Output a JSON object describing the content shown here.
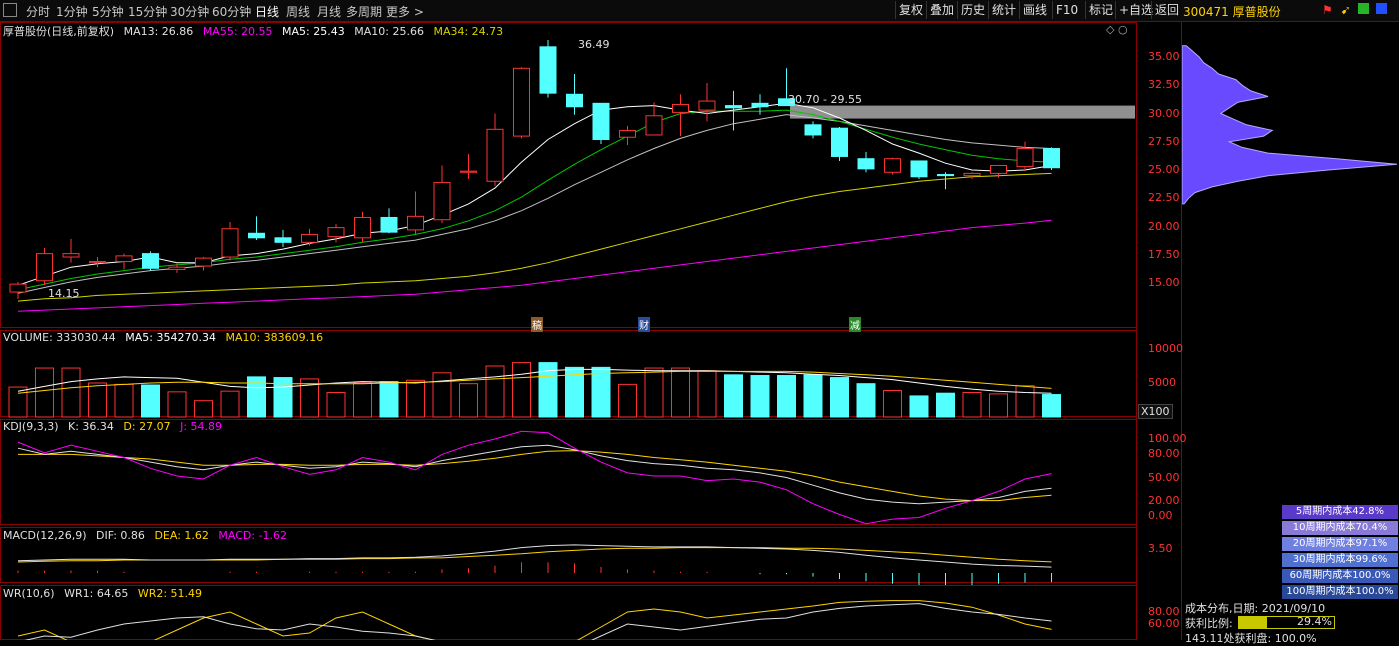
{
  "toolbar": {
    "period_tabs": [
      "分时",
      "1分钟",
      "5分钟",
      "15分钟",
      "30分钟",
      "60分钟",
      "日线",
      "周线",
      "月线",
      "多周期",
      "更多 >"
    ],
    "active_tab": "日线",
    "buttons": [
      "复权",
      "叠加",
      "历史",
      "统计",
      "画线",
      "F10",
      "标记",
      "+自选",
      "返回"
    ]
  },
  "stock": {
    "code_name": "300471 厚普股份",
    "title": "厚普股份(日线,前复权)"
  },
  "ma_legend": {
    "ma13": "MA13: 26.86",
    "ma55": "MA55: 20.55",
    "ma5": "MA5: 25.43",
    "ma10": "MA10: 25.66",
    "ma34": "MA34: 24.73"
  },
  "price_axis": [
    "35.00",
    "32.50",
    "30.00",
    "27.50",
    "25.00",
    "22.50",
    "20.00",
    "17.50",
    "15.00"
  ],
  "annotations": {
    "high": "36.49",
    "low": "14.15",
    "range": "30.70 - 29.55"
  },
  "markers": [
    "稿",
    "财",
    "减"
  ],
  "volume": {
    "legend_name": "VOLUME: 333030.44",
    "ma5": "MA5: 354270.34",
    "ma10": "MA10: 383609.16",
    "axis": [
      "10000",
      "5000"
    ],
    "unit": "X100"
  },
  "kdj": {
    "legend_name": "KDJ(9,3,3)",
    "k": "K: 36.34",
    "d": "D: 27.07",
    "j": "J: 54.89",
    "axis": [
      "100.00",
      "80.00",
      "50.00",
      "20.00",
      "0.00"
    ]
  },
  "macd": {
    "legend_name": "MACD(12,26,9)",
    "dif": "DIF: 0.86",
    "dea": "DEA: 1.62",
    "macd": "MACD: -1.62",
    "axis": [
      "3.50"
    ]
  },
  "wr": {
    "legend_name": "WR(10,6)",
    "wr1": "WR1: 64.65",
    "wr2": "WR2: 51.49",
    "axis": [
      "80.00",
      "60.00"
    ]
  },
  "cost_distribution": {
    "rows": [
      "5周期内成本42.8%",
      "10周期内成本70.4%",
      "20周期内成本97.1%",
      "30周期内成本99.6%",
      "60周期内成本100.0%",
      "100周期内成本100.0%"
    ],
    "date_line": "成本分布,日期: 2021/09/10",
    "profit_label": "获利比例:",
    "profit_value": "29.4%",
    "profit_fraction": 0.294,
    "bottom_line": "143.11处获利盘: 100.0%"
  },
  "colors": {
    "up": "#ff3232",
    "down": "#54ffff",
    "ma5": "#ffffff",
    "ma10": "#00c800",
    "ma13": "#c0c0c0",
    "ma34": "#d4d400",
    "ma55": "#ff00ff"
  },
  "candles": [
    [
      14.2,
      15.1,
      13.6,
      14.9
    ],
    [
      15.2,
      18.1,
      14.8,
      17.6
    ],
    [
      17.3,
      18.9,
      16.8,
      17.6
    ],
    [
      16.8,
      17.3,
      16.4,
      16.9
    ],
    [
      16.9,
      17.6,
      16.2,
      17.4
    ],
    [
      17.6,
      17.8,
      16.1,
      16.3
    ],
    [
      16.2,
      16.7,
      15.9,
      16.4
    ],
    [
      16.5,
      17.3,
      16.1,
      17.2
    ],
    [
      17.3,
      20.4,
      17.0,
      19.8
    ],
    [
      19.4,
      20.9,
      18.8,
      19.0
    ],
    [
      19.0,
      19.7,
      18.2,
      18.6
    ],
    [
      18.6,
      19.8,
      18.3,
      19.3
    ],
    [
      19.1,
      20.2,
      18.6,
      19.9
    ],
    [
      19.0,
      21.3,
      18.6,
      20.8
    ],
    [
      20.8,
      21.6,
      19.4,
      19.5
    ],
    [
      19.7,
      23.1,
      19.3,
      20.9
    ],
    [
      20.6,
      25.4,
      20.3,
      23.9
    ],
    [
      24.8,
      26.4,
      24.2,
      24.9
    ],
    [
      24.0,
      30.0,
      23.6,
      28.6
    ],
    [
      28.0,
      34.1,
      27.8,
      34.0
    ],
    [
      35.9,
      36.5,
      31.4,
      31.8
    ],
    [
      31.7,
      33.5,
      29.9,
      30.6
    ],
    [
      30.9,
      30.9,
      27.3,
      27.7
    ],
    [
      27.9,
      28.9,
      27.2,
      28.5
    ],
    [
      28.1,
      31.0,
      28.2,
      29.8
    ],
    [
      30.1,
      31.7,
      28.0,
      30.8
    ],
    [
      30.3,
      32.7,
      29.3,
      31.1
    ],
    [
      30.7,
      32.0,
      28.5,
      30.5
    ],
    [
      30.9,
      31.7,
      29.9,
      30.6
    ],
    [
      31.3,
      34.0,
      30.8,
      30.7
    ],
    [
      29.0,
      29.3,
      27.8,
      28.1
    ],
    [
      28.7,
      28.8,
      25.8,
      26.2
    ],
    [
      26.0,
      26.6,
      24.8,
      25.1
    ],
    [
      24.8,
      26.1,
      24.6,
      26.0
    ],
    [
      25.8,
      25.8,
      24.2,
      24.4
    ],
    [
      24.6,
      24.8,
      23.3,
      24.5
    ],
    [
      24.5,
      24.8,
      24.2,
      24.7
    ],
    [
      24.7,
      25.4,
      24.3,
      25.4
    ],
    [
      25.3,
      27.5,
      24.9,
      26.9
    ],
    [
      26.9,
      27.0,
      25.0,
      25.2
    ]
  ],
  "volumes": [
    4400,
    7200,
    7200,
    5000,
    4800,
    4700,
    3700,
    2400,
    3800,
    5900,
    5800,
    5600,
    3600,
    5000,
    5200,
    5400,
    6500,
    4900,
    7500,
    8000,
    8000,
    7300,
    7300,
    4800,
    7200,
    7200,
    6800,
    6200,
    6100,
    6100,
    6200,
    5800,
    4900,
    3900,
    3100,
    3500,
    3600,
    3400,
    4600,
    3300
  ],
  "ma_lines": {
    "ma5": [
      14.8,
      15.6,
      16.4,
      16.7,
      16.9,
      17.3,
      16.8,
      16.8,
      17.4,
      17.6,
      18.0,
      18.5,
      18.9,
      19.4,
      19.6,
      20.1,
      21.0,
      22.0,
      23.4,
      25.7,
      27.7,
      29.1,
      30.3,
      30.6,
      30.7,
      30.3,
      30.0,
      30.3,
      30.6,
      30.9,
      30.5,
      29.6,
      28.5,
      27.3,
      26.5,
      25.6,
      25.0,
      24.9,
      25.0,
      25.4
    ],
    "ma10": [
      14.4,
      14.9,
      15.4,
      15.8,
      16.1,
      16.4,
      16.6,
      16.8,
      17.1,
      17.3,
      17.6,
      17.9,
      18.2,
      18.6,
      18.9,
      19.3,
      19.8,
      20.5,
      21.4,
      22.6,
      24.1,
      25.5,
      26.8,
      28.0,
      29.2,
      30.0,
      30.2,
      30.2,
      30.2,
      30.3,
      29.9,
      29.3,
      28.6,
      27.9,
      27.3,
      26.8,
      26.3,
      26.0,
      25.8,
      25.7
    ],
    "ma13": [
      14.1,
      14.6,
      15.1,
      15.5,
      15.8,
      16.1,
      16.3,
      16.5,
      16.8,
      17.0,
      17.3,
      17.6,
      17.9,
      18.2,
      18.5,
      18.8,
      19.3,
      19.8,
      20.5,
      21.4,
      22.5,
      23.7,
      24.8,
      25.9,
      26.9,
      27.8,
      28.5,
      29.1,
      29.5,
      29.9,
      29.6,
      29.3,
      28.9,
      28.5,
      28.1,
      27.7,
      27.4,
      27.2,
      27.0,
      26.9
    ],
    "ma34": [
      13.4,
      13.6,
      13.7,
      13.9,
      14.0,
      14.1,
      14.2,
      14.3,
      14.4,
      14.5,
      14.6,
      14.7,
      14.8,
      15.0,
      15.1,
      15.2,
      15.4,
      15.6,
      15.9,
      16.3,
      16.8,
      17.4,
      18.0,
      18.6,
      19.2,
      19.8,
      20.4,
      21.0,
      21.6,
      22.2,
      22.7,
      23.1,
      23.4,
      23.7,
      24.0,
      24.2,
      24.4,
      24.5,
      24.6,
      24.7
    ],
    "ma55": [
      12.5,
      12.6,
      12.7,
      12.8,
      12.9,
      13.0,
      13.1,
      13.2,
      13.3,
      13.4,
      13.5,
      13.6,
      13.7,
      13.8,
      13.9,
      14.0,
      14.2,
      14.4,
      14.6,
      14.8,
      15.1,
      15.4,
      15.7,
      16.0,
      16.3,
      16.6,
      16.9,
      17.2,
      17.5,
      17.8,
      18.1,
      18.4,
      18.7,
      19.0,
      19.3,
      19.6,
      19.9,
      20.1,
      20.3,
      20.55
    ]
  },
  "vol_ma": {
    "ma5": [
      3800,
      4500,
      5200,
      5600,
      5900,
      5800,
      5700,
      5100,
      4500,
      4300,
      4400,
      4700,
      5000,
      5200,
      5100,
      5000,
      5300,
      5600,
      5900,
      6300,
      6800,
      7000,
      7000,
      6900,
      6800,
      6800,
      6800,
      6700,
      6600,
      6500,
      6300,
      6100,
      5800,
      5500,
      5000,
      4500,
      4100,
      3800,
      3600,
      3500
    ],
    "ma10": [
      3500,
      3900,
      4300,
      4600,
      4800,
      5000,
      5100,
      5100,
      5000,
      5000,
      4900,
      4900,
      4900,
      4900,
      5000,
      5100,
      5200,
      5400,
      5600,
      5800,
      6000,
      6200,
      6400,
      6500,
      6600,
      6700,
      6700,
      6700,
      6700,
      6700,
      6600,
      6400,
      6200,
      6000,
      5700,
      5400,
      5100,
      4800,
      4500,
      4200
    ]
  },
  "kdj_lines": {
    "k": [
      88,
      80,
      84,
      80,
      76,
      70,
      64,
      60,
      66,
      70,
      66,
      62,
      64,
      70,
      68,
      64,
      72,
      78,
      84,
      90,
      92,
      86,
      78,
      72,
      68,
      66,
      62,
      60,
      56,
      50,
      40,
      30,
      22,
      18,
      16,
      18,
      20,
      24,
      32,
      36
    ],
    "d": [
      80,
      80,
      80,
      78,
      76,
      74,
      70,
      66,
      66,
      67,
      67,
      66,
      66,
      67,
      67,
      66,
      68,
      71,
      75,
      80,
      84,
      85,
      83,
      80,
      76,
      73,
      70,
      66,
      62,
      58,
      52,
      44,
      38,
      32,
      26,
      22,
      20,
      20,
      24,
      27
    ],
    "j": [
      96,
      82,
      92,
      84,
      76,
      62,
      52,
      48,
      66,
      76,
      64,
      54,
      60,
      76,
      70,
      60,
      80,
      92,
      100,
      110,
      108,
      88,
      70,
      56,
      52,
      52,
      46,
      48,
      44,
      34,
      16,
      2,
      -10,
      -4,
      -2,
      10,
      20,
      32,
      48,
      55
    ]
  },
  "macd_lines": {
    "dif": [
      1.8,
      1.9,
      2.0,
      2.0,
      2.0,
      1.9,
      1.9,
      1.9,
      2.0,
      2.0,
      2.0,
      2.1,
      2.1,
      2.2,
      2.2,
      2.3,
      2.5,
      2.8,
      3.2,
      3.7,
      4.0,
      4.1,
      4.0,
      3.9,
      3.8,
      3.8,
      3.8,
      3.7,
      3.6,
      3.5,
      3.3,
      3.0,
      2.6,
      2.2,
      1.9,
      1.6,
      1.3,
      1.1,
      1.0,
      0.86
    ],
    "dea": [
      1.6,
      1.7,
      1.8,
      1.8,
      1.9,
      1.9,
      1.9,
      1.9,
      1.9,
      1.9,
      2.0,
      2.0,
      2.0,
      2.1,
      2.1,
      2.2,
      2.2,
      2.4,
      2.6,
      2.8,
      3.1,
      3.3,
      3.5,
      3.6,
      3.6,
      3.7,
      3.7,
      3.7,
      3.7,
      3.6,
      3.6,
      3.5,
      3.3,
      3.1,
      2.9,
      2.6,
      2.3,
      2.0,
      1.8,
      1.62
    ]
  },
  "wr_lines": {
    "wr1": [
      30,
      40,
      38,
      50,
      60,
      65,
      70,
      72,
      60,
      52,
      50,
      60,
      55,
      48,
      45,
      40,
      30,
      20,
      10,
      5,
      4,
      20,
      40,
      60,
      55,
      50,
      56,
      62,
      68,
      70,
      80,
      86,
      90,
      92,
      94,
      86,
      80,
      76,
      70,
      65
    ],
    "wr2": [
      40,
      50,
      30,
      20,
      20,
      30,
      50,
      70,
      80,
      60,
      40,
      45,
      70,
      80,
      60,
      40,
      30,
      15,
      5,
      3,
      5,
      30,
      55,
      80,
      85,
      80,
      70,
      75,
      80,
      85,
      90,
      96,
      98,
      99,
      99,
      95,
      88,
      75,
      60,
      51
    ]
  },
  "cost_profile": {
    "prices": [
      36.0,
      35.5,
      35.0,
      34.5,
      34.0,
      33.5,
      33.0,
      32.5,
      32.0,
      31.5,
      31.0,
      30.5,
      30.0,
      29.5,
      29.0,
      28.5,
      28.0,
      27.5,
      27.0,
      26.5,
      26.0,
      25.5,
      25.0,
      24.5,
      24.0,
      23.5,
      23.0,
      22.5,
      22.0
    ],
    "amounts": [
      0.02,
      0.05,
      0.08,
      0.1,
      0.14,
      0.17,
      0.25,
      0.28,
      0.32,
      0.4,
      0.26,
      0.22,
      0.18,
      0.24,
      0.3,
      0.42,
      0.38,
      0.22,
      0.28,
      0.4,
      0.72,
      1.0,
      0.68,
      0.4,
      0.26,
      0.14,
      0.06,
      0.03,
      0.01
    ]
  }
}
